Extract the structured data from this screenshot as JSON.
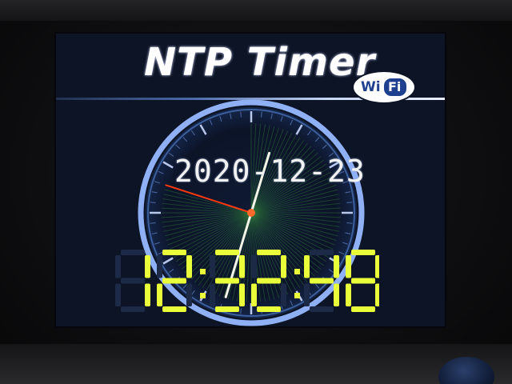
{
  "header": {
    "title": "NTP Timer",
    "badge_wi": "Wi",
    "badge_fi": "Fi",
    "badge_icon": "wifi-logo-icon"
  },
  "clock": {
    "date": "2020-12-23",
    "time": "12:32:48",
    "hour": 12,
    "minute": 32,
    "second": 48
  },
  "colors": {
    "screen_bg": "#0d1426",
    "dial_ring": "#8fb0f5",
    "second_hand": "#ff3a10",
    "minute_hand": "#f4f4e8",
    "digit_on": "#e8ff3a",
    "digit_off": "#1c2a48",
    "title": "#ffffff"
  }
}
